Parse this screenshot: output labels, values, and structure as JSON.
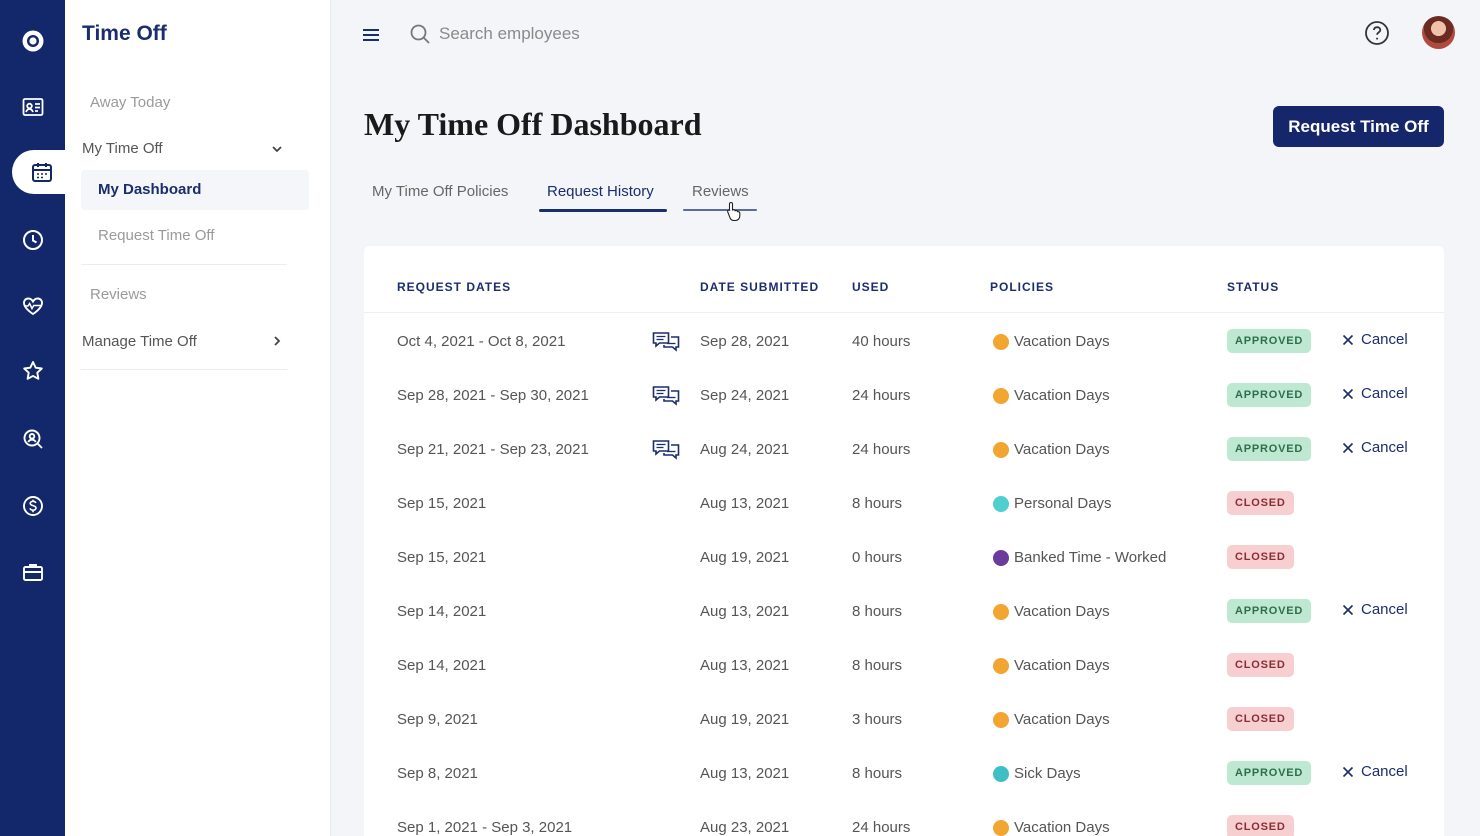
{
  "subnav": {
    "title": "Time Off",
    "away_today": "Away Today",
    "my_time_off": "My Time Off",
    "my_dashboard": "My Dashboard",
    "request_time_off": "Request Time Off",
    "reviews": "Reviews",
    "manage_time_off": "Manage Time Off"
  },
  "topbar": {
    "search_placeholder": "Search employees"
  },
  "page": {
    "title": "My Time Off Dashboard",
    "request_button": "Request Time Off",
    "tabs": [
      "My Time Off Policies",
      "Request History",
      "Reviews"
    ],
    "active_tab": "Request History"
  },
  "table": {
    "headers": [
      "REQUEST DATES",
      "DATE SUBMITTED",
      "USED",
      "POLICIES",
      "STATUS"
    ],
    "cancel_label": "Cancel",
    "rows": [
      {
        "dates": "Oct 4, 2021 - Oct 8, 2021",
        "comment": true,
        "submitted": "Sep 28, 2021",
        "used": "40 hours",
        "policy": "Vacation Days",
        "policy_color": "#f2a531",
        "status": "APPROVED",
        "cancel": true
      },
      {
        "dates": "Sep 28, 2021 - Sep 30, 2021",
        "comment": true,
        "submitted": "Sep 24, 2021",
        "used": "24 hours",
        "policy": "Vacation Days",
        "policy_color": "#f2a531",
        "status": "APPROVED",
        "cancel": true
      },
      {
        "dates": "Sep 21, 2021 - Sep 23, 2021",
        "comment": true,
        "submitted": "Aug 24, 2021",
        "used": "24 hours",
        "policy": "Vacation Days",
        "policy_color": "#f2a531",
        "status": "APPROVED",
        "cancel": true
      },
      {
        "dates": "Sep 15, 2021",
        "comment": false,
        "submitted": "Aug 13, 2021",
        "used": "8 hours",
        "policy": "Personal Days",
        "policy_color": "#4fcfd0",
        "status": "CLOSED",
        "cancel": false
      },
      {
        "dates": "Sep 15, 2021",
        "comment": false,
        "submitted": "Aug 19, 2021",
        "used": "0 hours",
        "policy": "Banked Time - Worked",
        "policy_color": "#6a3b9c",
        "status": "CLOSED",
        "cancel": false
      },
      {
        "dates": "Sep 14, 2021",
        "comment": false,
        "submitted": "Aug 13, 2021",
        "used": "8 hours",
        "policy": "Vacation Days",
        "policy_color": "#f2a531",
        "status": "APPROVED",
        "cancel": true
      },
      {
        "dates": "Sep 14, 2021",
        "comment": false,
        "submitted": "Aug 13, 2021",
        "used": "8 hours",
        "policy": "Vacation Days",
        "policy_color": "#f2a531",
        "status": "CLOSED",
        "cancel": false
      },
      {
        "dates": "Sep 9, 2021",
        "comment": false,
        "submitted": "Aug 19, 2021",
        "used": "3 hours",
        "policy": "Vacation Days",
        "policy_color": "#f2a531",
        "status": "CLOSED",
        "cancel": false
      },
      {
        "dates": "Sep 8, 2021",
        "comment": false,
        "submitted": "Aug 13, 2021",
        "used": "8 hours",
        "policy": "Sick Days",
        "policy_color": "#3fbfc4",
        "status": "APPROVED",
        "cancel": true
      },
      {
        "dates": "Sep 1, 2021 - Sep 3, 2021",
        "comment": false,
        "submitted": "Aug 23, 2021",
        "used": "24 hours",
        "policy": "Vacation Days",
        "policy_color": "#f2a531",
        "status": "CLOSED",
        "cancel": false
      }
    ]
  },
  "colors": {
    "brand": "#16266b",
    "rail": "#13286a",
    "approved_bg": "#bfe8d2",
    "closed_bg": "#f7cfd1"
  },
  "icons": [
    "logo-icon",
    "id-card-icon",
    "calendar-icon",
    "clock-icon",
    "heart-icon",
    "star-icon",
    "search-person-icon",
    "dollar-icon",
    "briefcase-icon",
    "hamburger-icon",
    "search-icon",
    "help-icon",
    "comment-icon",
    "close-icon",
    "chevron-down-icon",
    "chevron-right-icon"
  ]
}
